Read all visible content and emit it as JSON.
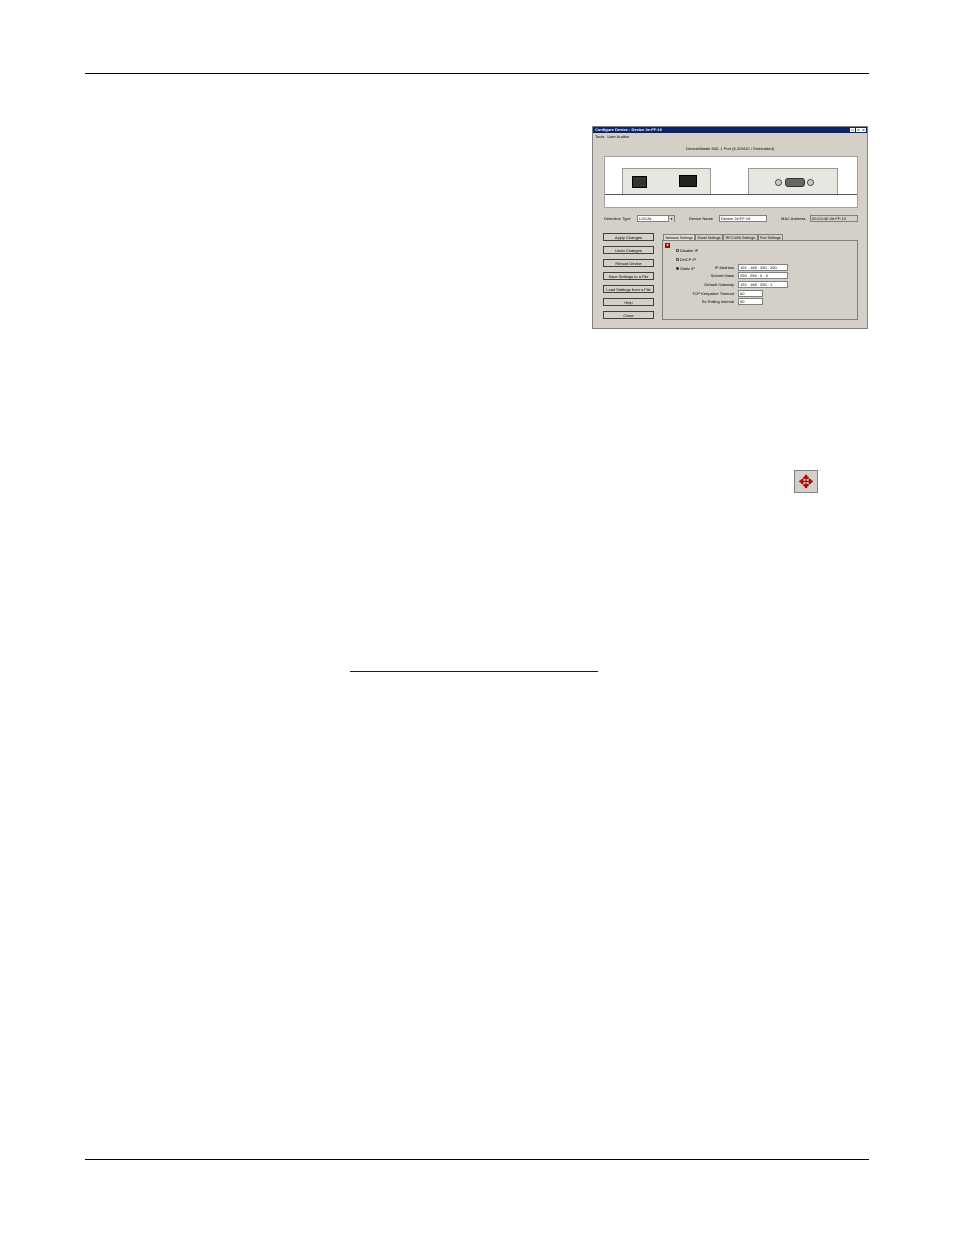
{
  "dialog": {
    "title": "Configure Device : Device 2e:FF:19",
    "window_buttons": [
      "_",
      "□",
      "×"
    ],
    "menu": [
      "Tools",
      "User Auditor"
    ],
    "model_line": "DeviceMaster 500, 1 Port (5-30VDC / Embedded)",
    "detection_type_label": "Detection Type",
    "detection_type_value": "LOCAL",
    "device_name_label": "Device Name",
    "device_name_value": "Device 2e:FF:19",
    "mac_label": "MAC Address",
    "mac_value": "00:C0:4E:2e:FF:19",
    "buttons": [
      "Apply Changes",
      "Undo Changes",
      "Reboot Device",
      "Save Settings to a File",
      "Load Settings from a File",
      "Help",
      "Close"
    ],
    "tabs": [
      "Network Settings",
      "Email Settings",
      "RFC1006 Settings",
      "Port Settings"
    ],
    "radios": [
      "Disable IP",
      "DHCP IP",
      "Static IP"
    ],
    "selected_radio": "Static IP",
    "network": {
      "ip_label": "IP Address",
      "ip_value": "192 . 168 . 250 . 250",
      "mask_label": "Subnet Mask",
      "mask_value": "255 . 255 . 0 . 0",
      "gateway_label": "Default Gateway",
      "gateway_value": "192 . 168 . 250 . 1",
      "keepalive_label": "TCP Keepalive Timeout",
      "keepalive_value": "60",
      "polling_label": "Rx Polling Interval",
      "polling_value": "50"
    }
  },
  "icons": {
    "move_icon": "four-way-arrow-move-icon",
    "color": "#b00000"
  },
  "colors": {
    "titlebar": "#0a246a",
    "dialog_bg": "#d4d0c8",
    "link": "#0000ff"
  }
}
